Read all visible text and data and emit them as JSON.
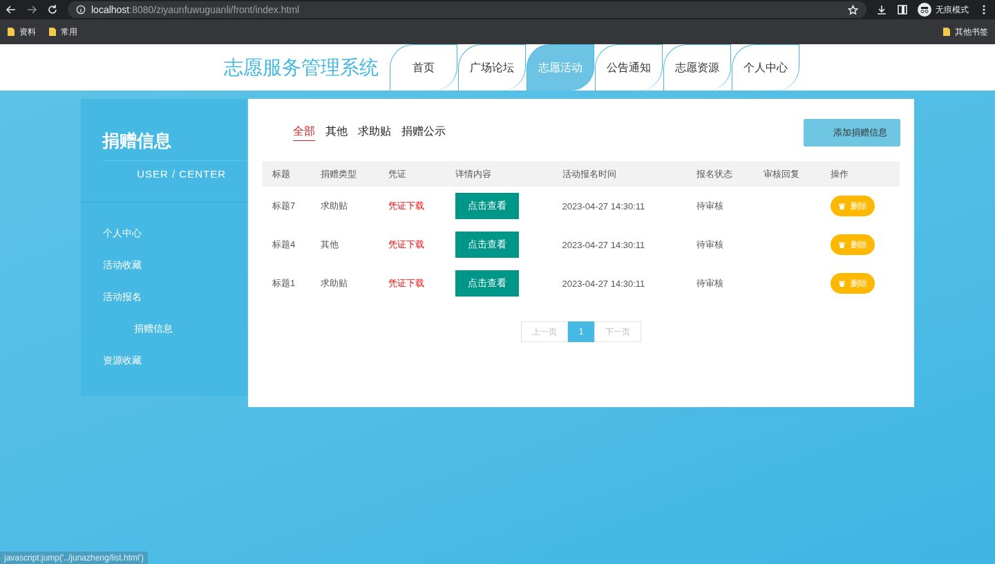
{
  "browser": {
    "url_host": "localhost",
    "url_rest": ":8080/ziyaunfuwuguanli/front/index.html",
    "profile": "无痕模式",
    "bookmarks": [
      "资料",
      "常用"
    ],
    "other_bookmarks": "其他书签"
  },
  "header": {
    "title": "志愿服务管理系统",
    "nav": [
      {
        "label": "首页",
        "selected": false
      },
      {
        "label": "广场论坛",
        "selected": false
      },
      {
        "label": "志愿活动",
        "selected": true
      },
      {
        "label": "公告通知",
        "selected": false
      },
      {
        "label": "志愿资源",
        "selected": false
      },
      {
        "label": "个人中心",
        "selected": false
      }
    ]
  },
  "sidebar": {
    "title": "捐赠信息",
    "subtitle": "USER / CENTER",
    "items": [
      {
        "label": "个人中心"
      },
      {
        "label": "活动收藏"
      },
      {
        "label": "活动报名",
        "children": [
          {
            "label": "捐赠信息"
          }
        ]
      },
      {
        "label": "资源收藏"
      }
    ]
  },
  "filters": [
    {
      "label": "全部",
      "selected": true
    },
    {
      "label": "其他",
      "selected": false
    },
    {
      "label": "求助贴",
      "selected": false
    },
    {
      "label": "捐赠公示",
      "selected": false
    }
  ],
  "add_button": "添加捐赠信息",
  "table": {
    "columns": [
      "标题",
      "捐赠类型",
      "凭证",
      "详情内容",
      "活动报名时间",
      "报名状态",
      "审核回复",
      "操作"
    ],
    "rows": [
      {
        "title": "标题7",
        "type": "求助贴",
        "voucher": "凭证下载",
        "detail": "点击查看",
        "time": "2023-04-27 14:30:11",
        "status": "待审核",
        "action": "删除"
      },
      {
        "title": "标题4",
        "type": "其他",
        "voucher": "凭证下载",
        "detail": "点击查看",
        "time": "2023-04-27 14:30:11",
        "status": "待审核",
        "action": "删除"
      },
      {
        "title": "标题1",
        "type": "求助贴",
        "voucher": "凭证下载",
        "detail": "点击查看",
        "time": "2023-04-27 14:30:11",
        "status": "待审核",
        "action": "删除"
      }
    ]
  },
  "pagination": {
    "prev": "上一页",
    "pages": [
      {
        "label": "1",
        "selected": true
      }
    ],
    "next": "下一页"
  },
  "status_bar": "javascript:jump('../junazheng/list.html')"
}
